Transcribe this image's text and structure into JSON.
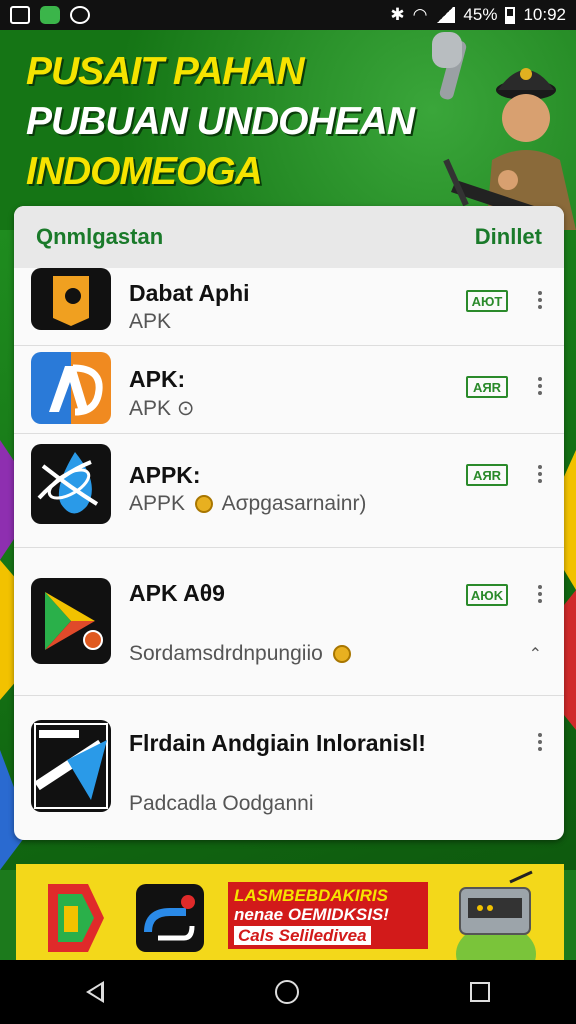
{
  "status_bar": {
    "battery": "45%",
    "time": "10:92"
  },
  "hero": {
    "line1": "PUSAIT PAHAN",
    "line2": "PUBUAN  UNDOHEAN",
    "line3": "INDOMEOGA"
  },
  "card": {
    "title": "Qnmlgastan",
    "action": "Dinllet"
  },
  "apps": [
    {
      "name": "Dabat Aphi",
      "subtitle": "APK",
      "badge": "AЮT"
    },
    {
      "name": "APK:",
      "subtitle": "APK ⊙",
      "badge": "AЯR"
    },
    {
      "name": "APPK:",
      "subtitle_a": "APPK",
      "subtitle_b": "Aσpgasarnainr)",
      "badge": "AЯR"
    },
    {
      "name": "APK Aθ9",
      "subtitle": "Sordamsdrdnpungiio",
      "badge": "AЮK"
    },
    {
      "name": "Flrdain Andgiain Inloranisl!",
      "subtitle": "Padcadla Oodganni"
    }
  ],
  "banner": {
    "line1": "LASMBEBDAKIRIS",
    "line2": "nenae OEMIDKSIS!",
    "line3": "Cals Seliledivea"
  },
  "colors": {
    "hero_green": "#1c7a1c",
    "hero_yellow": "#f6e300",
    "accent_green": "#2a8a2a",
    "banner_yellow": "#f3d81a",
    "banner_red": "#d21a1a"
  }
}
